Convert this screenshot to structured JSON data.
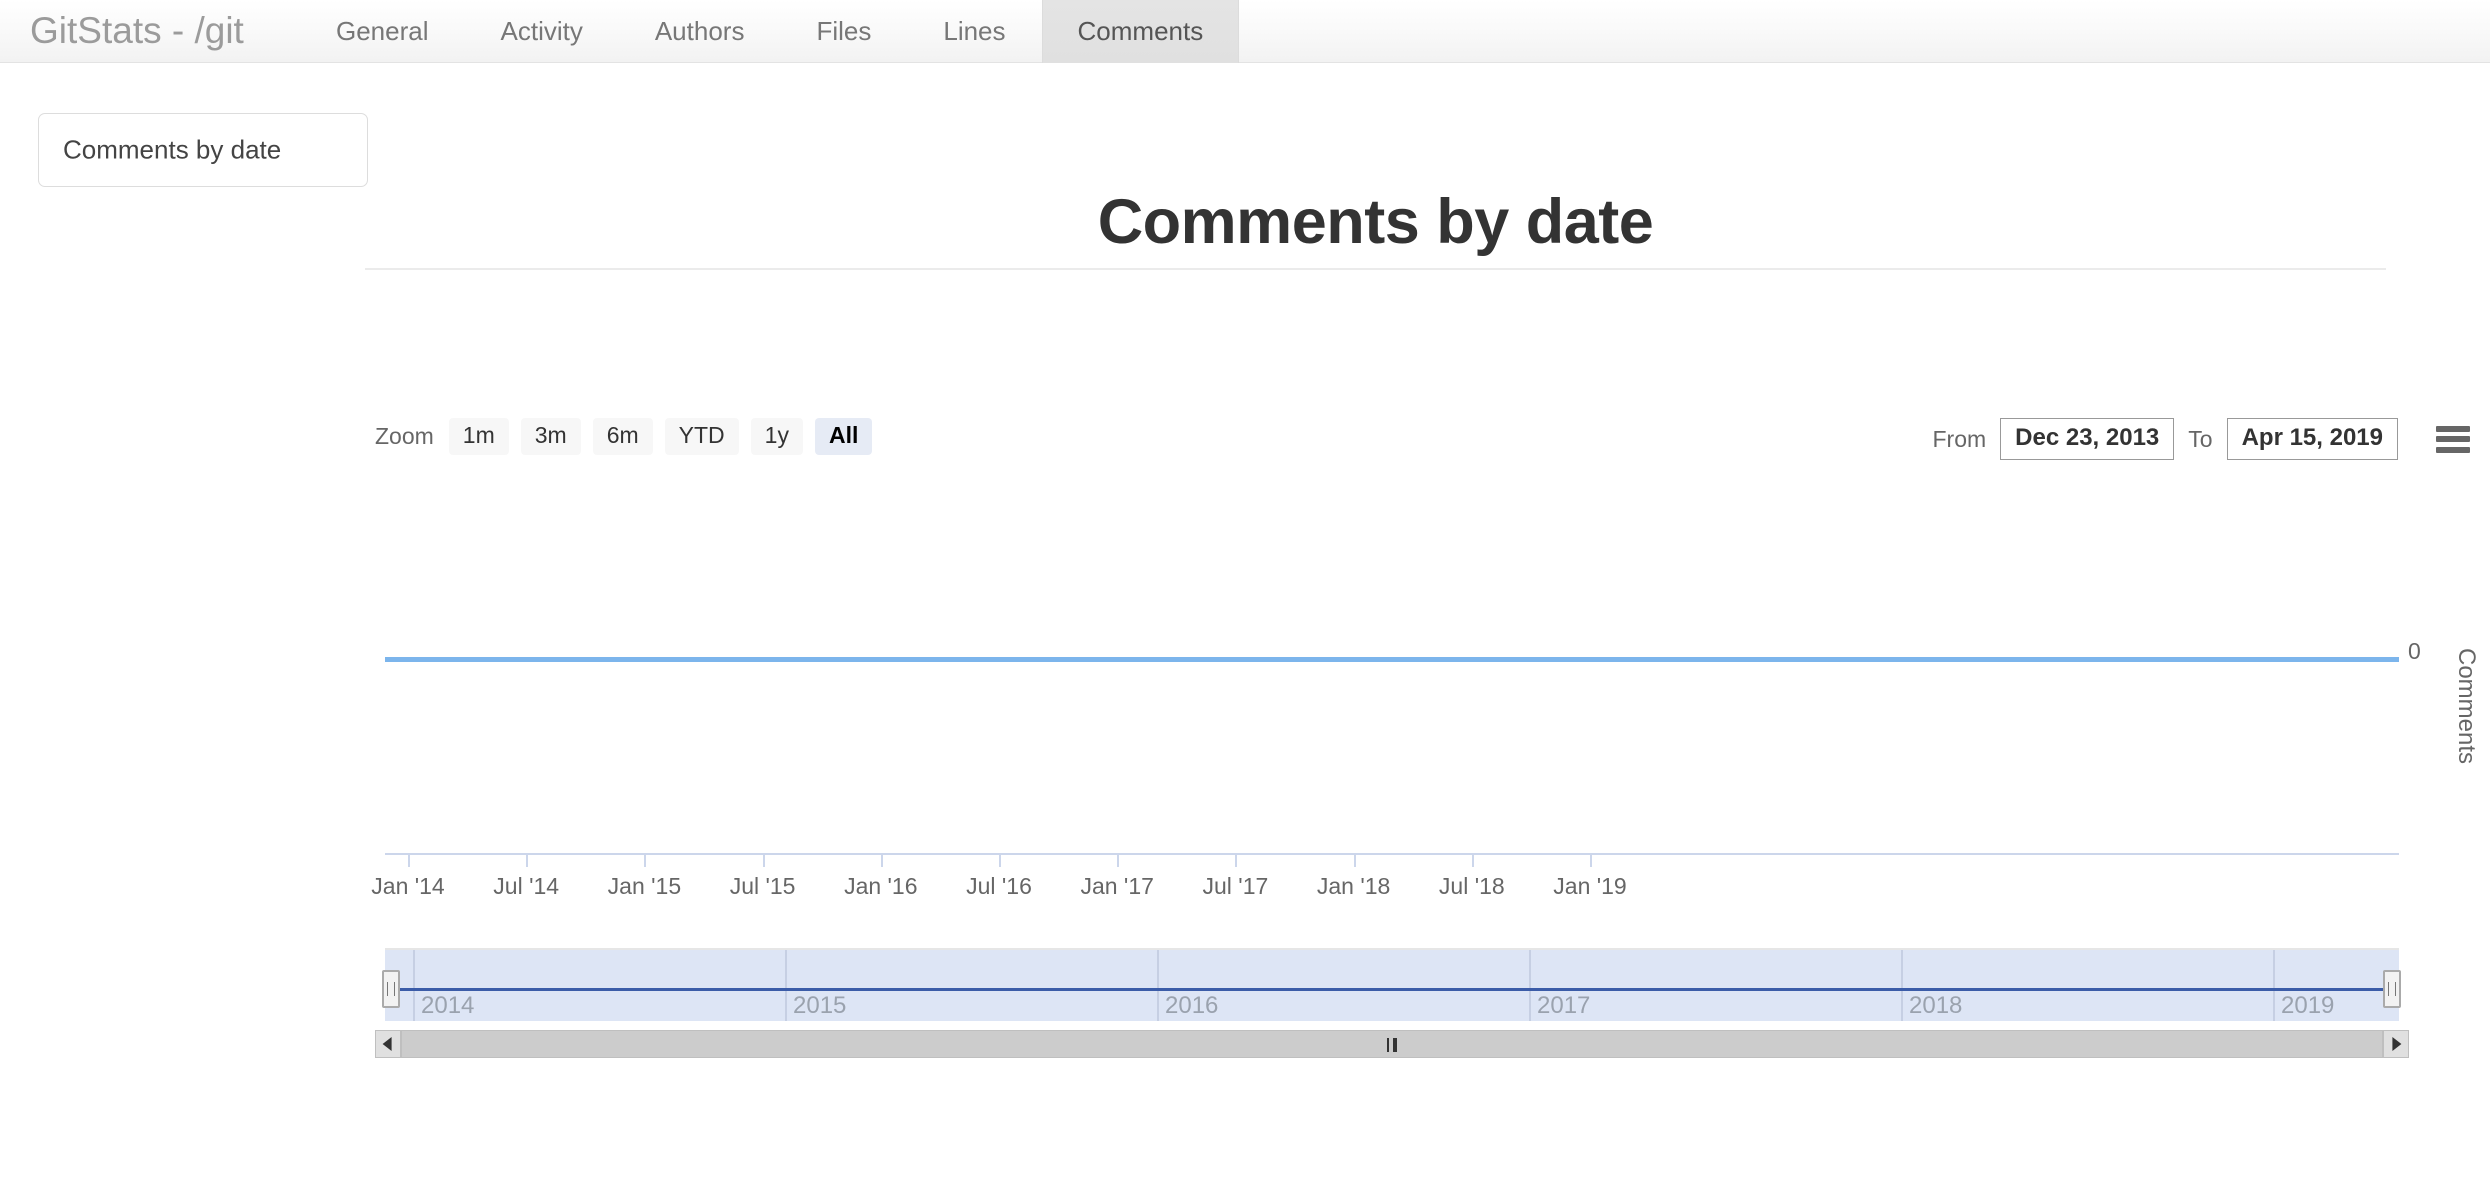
{
  "navbar": {
    "brand": "GitStats - /git",
    "tabs": [
      {
        "label": "General",
        "active": false
      },
      {
        "label": "Activity",
        "active": false
      },
      {
        "label": "Authors",
        "active": false
      },
      {
        "label": "Files",
        "active": false
      },
      {
        "label": "Lines",
        "active": false
      },
      {
        "label": "Comments",
        "active": true
      }
    ]
  },
  "sidebar": {
    "items": [
      {
        "label": "Comments by date"
      }
    ]
  },
  "main": {
    "title": "Comments by date"
  },
  "rangeselector": {
    "zoom_label": "Zoom",
    "buttons": [
      {
        "label": "1m",
        "selected": false
      },
      {
        "label": "3m",
        "selected": false
      },
      {
        "label": "6m",
        "selected": false
      },
      {
        "label": "YTD",
        "selected": false
      },
      {
        "label": "1y",
        "selected": false
      },
      {
        "label": "All",
        "selected": true
      }
    ],
    "from_label": "From",
    "from_value": "Dec 23, 2013",
    "to_label": "To",
    "to_value": "Apr 15, 2019",
    "menu_icon": "hamburger-menu-icon"
  },
  "chart_data": {
    "type": "line",
    "title": "Comments by date",
    "xlabel": "",
    "ylabel": "Comments",
    "series": [
      {
        "name": "Comments",
        "color": "#7cb5ec",
        "values": [
          0,
          0,
          0,
          0,
          0,
          0,
          0,
          0,
          0,
          0,
          0,
          0
        ]
      }
    ],
    "x_tick_labels": [
      "Jan '14",
      "Jul '14",
      "Jan '15",
      "Jul '15",
      "Jan '16",
      "Jul '16",
      "Jan '17",
      "Jul '17",
      "Jan '18",
      "Jul '18",
      "Jan '19"
    ],
    "y_tick_labels": [
      "0"
    ],
    "ylim": [
      0,
      1
    ],
    "x_range": [
      "Dec 23, 2013",
      "Apr 15, 2019"
    ],
    "grid": false,
    "legend": "none",
    "navigator": {
      "year_labels": [
        "2014",
        "2015",
        "2016",
        "2017",
        "2018",
        "2019"
      ],
      "series_color": "#3b5ca8",
      "mask_color": "#dde5f5",
      "selected_range": [
        "Dec 23, 2013",
        "Apr 15, 2019"
      ]
    }
  }
}
